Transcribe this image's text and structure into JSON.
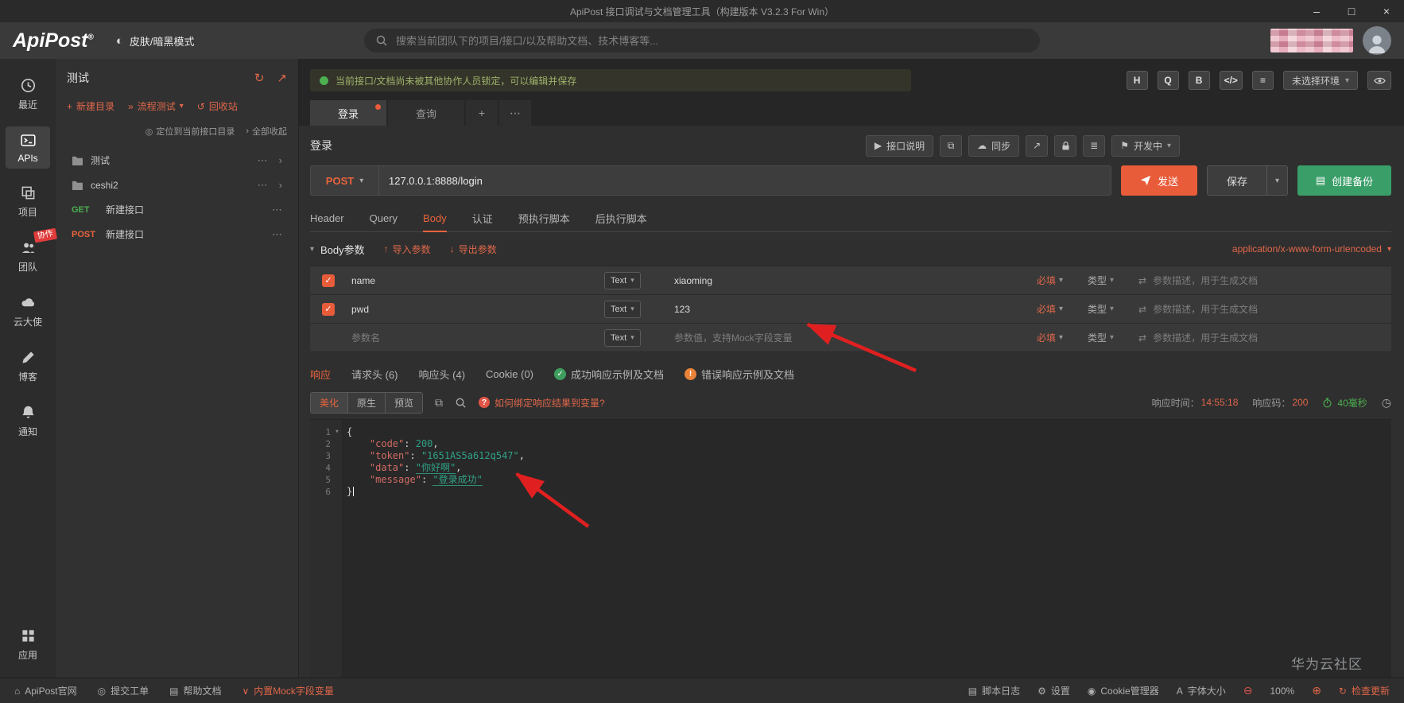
{
  "titlebar": {
    "title": "ApiPost 接口调试与文档管理工具（构建版本 V3.2.3 For Win）"
  },
  "header": {
    "logo_text": "ApiPost",
    "logo_reg": "®",
    "skin_label": "皮肤/暗黑模式",
    "search_placeholder": "搜索当前团队下的项目/接口/以及帮助文档、技术博客等..."
  },
  "sidebar": {
    "recent": "最近",
    "apis": "APIs",
    "project": "项目",
    "team": "团队",
    "team_badge": "协作",
    "cloud": "云大使",
    "blog": "博客",
    "notify": "通知",
    "apps": "应用"
  },
  "explorer": {
    "title": "测试",
    "new_dir": "新建目录",
    "flow_test": "流程测试",
    "recycle": "回收站",
    "locate": "定位到当前接口目录",
    "collapse_all": "全部收起",
    "folder1": "测试",
    "folder2": "ceshi2",
    "api1_method": "GET",
    "api1_label": "新建接口",
    "api2_method": "POST",
    "api2_label": "新建接口"
  },
  "notice": {
    "text": "当前接口/文档尚未被其他协作人员锁定，可以编辑并保存"
  },
  "top_tools": {
    "h": "H",
    "q": "Q",
    "b": "B",
    "code": "</>",
    "filter": "≡",
    "env_label": "未选择环境"
  },
  "doc_tabs": {
    "active": "登录",
    "second": "查询",
    "add": "+",
    "more": "⋯"
  },
  "api": {
    "name": "登录",
    "doc_btn": "接口说明",
    "sync_btn": "同步",
    "status_btn": "开发中",
    "method": "POST",
    "url": "127.0.0.1:8888/login",
    "send_btn": "发送",
    "save_btn": "保存",
    "backup_btn": "创建备份"
  },
  "request_tabs": {
    "t0": "Header",
    "t1": "Query",
    "t2": "Body",
    "t3": "认证",
    "t4": "预执行脚本",
    "t5": "后执行脚本"
  },
  "body_panel": {
    "title": "Body参数",
    "import_label": "导入参数",
    "export_label": "导出参数",
    "content_type": "application/x-www-form-urlencoded",
    "type_btn": "Text",
    "required_label": "必填",
    "type_label": "类型",
    "desc_placeholder": "参数描述，用于生成文档",
    "row1_name": "name",
    "row1_value": "xiaoming",
    "row2_name": "pwd",
    "row2_value": "123",
    "row3_name_placeholder": "参数名",
    "row3_value_placeholder": "参数值，支持Mock字段变量"
  },
  "response_tabs": {
    "t0": "响应",
    "t1": "请求头 (6)",
    "t2": "响应头 (4)",
    "t3": "Cookie (0)",
    "t4": "成功响应示例及文档",
    "t5": "错误响应示例及文档"
  },
  "response_toolbar": {
    "beautify": "美化",
    "raw": "原生",
    "preview": "预览",
    "help_text": "如何绑定响应结果到变量?",
    "time_label": "响应时间：",
    "time_value": "14:55:18",
    "code_label": "响应码：",
    "code_value": "200",
    "duration": "40毫秒"
  },
  "response_body": {
    "lines": [
      {
        "n": "1",
        "tokens": [
          [
            "p",
            "{"
          ]
        ]
      },
      {
        "n": "2",
        "tokens": [
          [
            "p",
            "    "
          ],
          [
            "k",
            "\"code\""
          ],
          [
            "p",
            ": "
          ],
          [
            "v",
            "200"
          ],
          [
            "p",
            ","
          ]
        ]
      },
      {
        "n": "3",
        "tokens": [
          [
            "p",
            "    "
          ],
          [
            "k",
            "\"token\""
          ],
          [
            "p",
            ": "
          ],
          [
            "v",
            "\"1651AS5a612q547\""
          ],
          [
            "p",
            ","
          ]
        ]
      },
      {
        "n": "4",
        "tokens": [
          [
            "p",
            "    "
          ],
          [
            "k",
            "\"data\""
          ],
          [
            "p",
            ": "
          ],
          [
            "vu",
            "\"你好啊\""
          ],
          [
            "p",
            ","
          ]
        ]
      },
      {
        "n": "5",
        "tokens": [
          [
            "p",
            "    "
          ],
          [
            "k",
            "\"message\""
          ],
          [
            "p",
            ": "
          ],
          [
            "vu",
            "\"登录成功\""
          ]
        ]
      },
      {
        "n": "6",
        "tokens": [
          [
            "p",
            "}"
          ]
        ]
      }
    ]
  },
  "statusbar": {
    "site": "ApiPost官网",
    "ticket": "提交工单",
    "helpdoc": "帮助文档",
    "mock": "内置Mock字段变量",
    "script_log": "脚本日志",
    "settings": "设置",
    "cookie": "Cookie管理器",
    "fontsize": "字体大小",
    "zoom": "100%",
    "update": "检查更新"
  },
  "watermark": "华为云社区",
  "icons": {
    "minimize": "–",
    "maximize": "□",
    "close": "×",
    "skin": "◐",
    "refresh": "↻",
    "share": "↗",
    "plus": "+",
    "flow": "»",
    "recycle": "↺",
    "locate": "◎",
    "collapse": "›",
    "more": "⋯",
    "chevron": "›",
    "caret": "▾",
    "play": "▶",
    "copy": "⧉",
    "cloud": "☁",
    "db": "≣",
    "flag": "⚑",
    "list": "▤",
    "check": "✓",
    "warn": "!",
    "question": "?",
    "import": "↑",
    "export": "↓",
    "swap": "⇄",
    "history": "◷",
    "home": "⌂",
    "ticket": "◎",
    "doc": "▤",
    "mock": "∨",
    "log": "▤",
    "gear": "⚙",
    "cookie": "◉",
    "font": "A",
    "minus_circle": "⊖",
    "plus_circle": "⊕",
    "update": "↻"
  },
  "colors": {
    "accent": "#e85c3a",
    "green": "#3a9e68",
    "arrow": "#e02020"
  }
}
